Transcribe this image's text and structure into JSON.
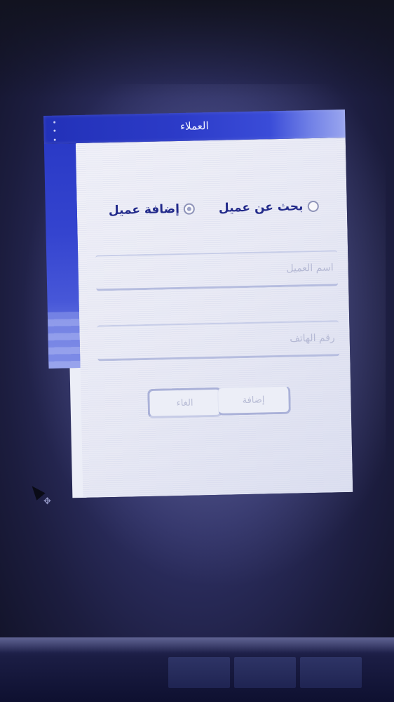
{
  "window": {
    "title": "العملاء"
  },
  "mode_options": [
    {
      "label": "إضافة عميل",
      "checked": true
    },
    {
      "label": "بحث عن عميل",
      "checked": false
    }
  ],
  "form": {
    "name_placeholder": "اسم العميل",
    "phone_placeholder": "رقم الهاتف",
    "add_label": "إضافة",
    "cancel_label": "الغاء"
  },
  "icons": {
    "menu": "vertical-dots-icon",
    "pointer": "arrow-cursor-icon",
    "move": "move-cursor-icon"
  },
  "colors": {
    "titlebar": "#2c3bc8",
    "radio_label": "#222a8a",
    "dialog_bg": "#eceef7"
  }
}
